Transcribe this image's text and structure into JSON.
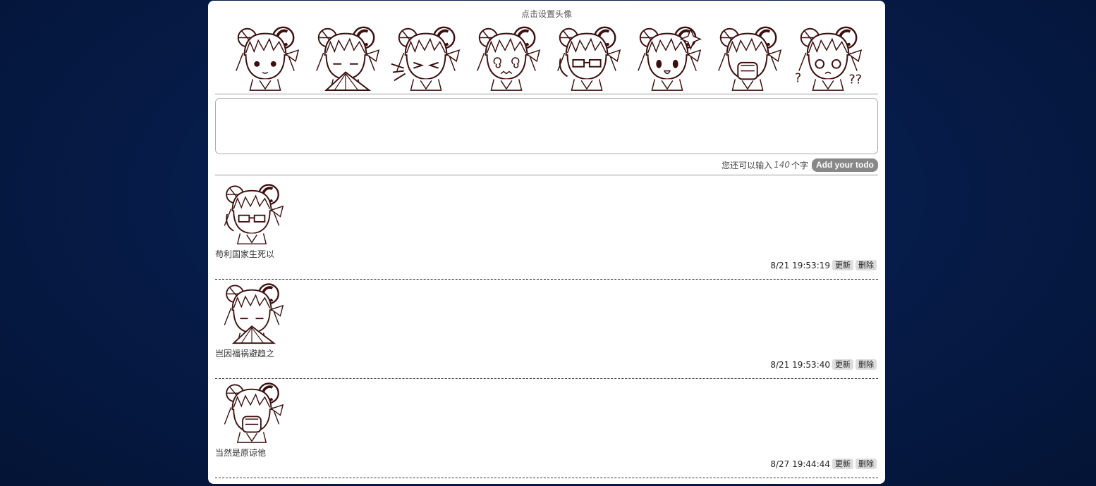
{
  "header": {
    "avatar_title": "点击设置头像",
    "avatars": [
      {
        "icon": "chibi-smile-icon"
      },
      {
        "icon": "chibi-fan-crying-icon"
      },
      {
        "icon": "chibi-sneeze-icon"
      },
      {
        "icon": "chibi-dizzy-icon"
      },
      {
        "icon": "chibi-glasses-icon"
      },
      {
        "icon": "chibi-sparkle-icon"
      },
      {
        "icon": "chibi-hands-face-icon"
      },
      {
        "icon": "chibi-confused-icon"
      }
    ]
  },
  "editor": {
    "placeholder": "",
    "value": "",
    "counter_prefix": "您还可以输入",
    "counter_value": "140",
    "counter_suffix": "个字",
    "add_button": "Add your todo"
  },
  "todos": [
    {
      "avatar_index": 4,
      "text": "苟利国家生死以",
      "time": "8/21 19:53:19",
      "update_label": "更新",
      "delete_label": "删除"
    },
    {
      "avatar_index": 1,
      "text": "岂因福祸避趋之",
      "time": "8/21 19:53:40",
      "update_label": "更新",
      "delete_label": "删除"
    },
    {
      "avatar_index": 6,
      "text": "当然是原谅他",
      "time": "8/27 19:44:44",
      "update_label": "更新",
      "delete_label": "删除"
    }
  ],
  "colors": {
    "background": "#061c4a",
    "panel": "#ffffff",
    "line_art": "#3a0f0f",
    "add_button": "#888888"
  }
}
